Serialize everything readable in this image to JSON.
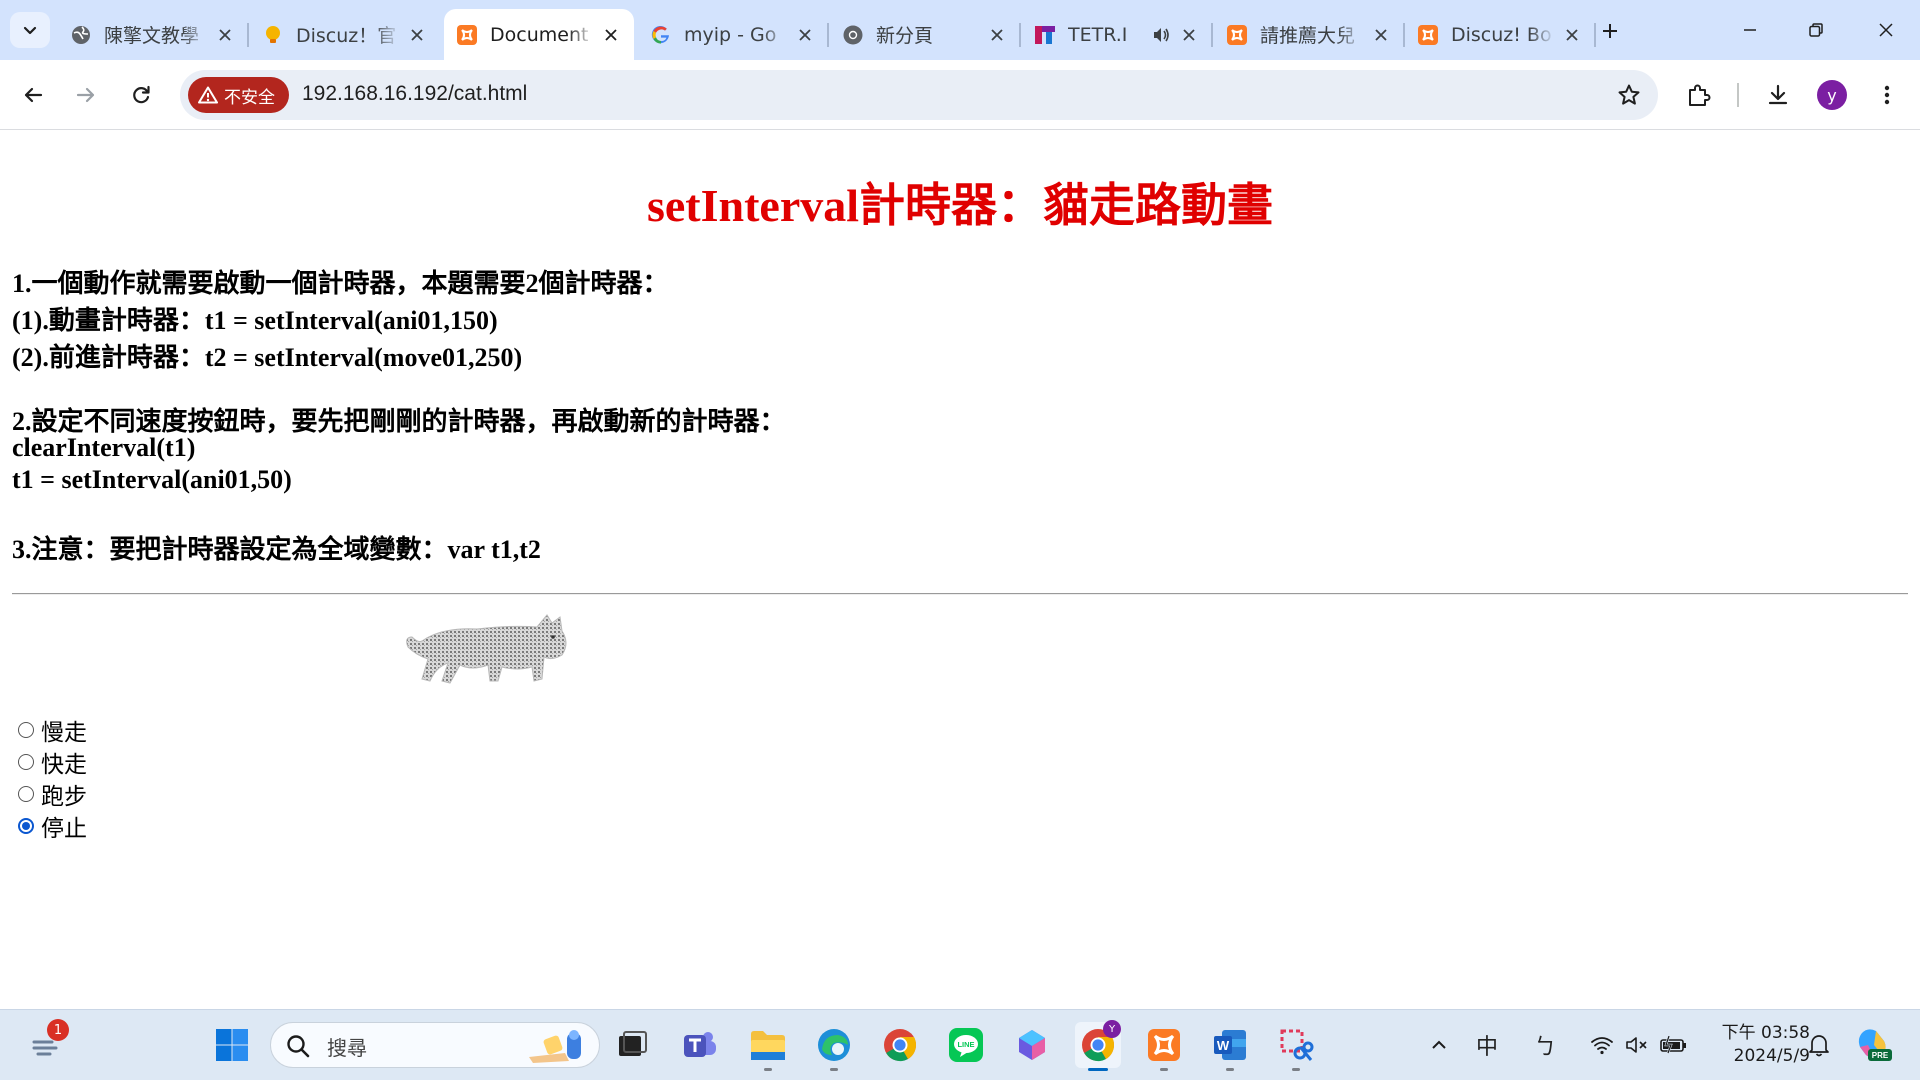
{
  "browser": {
    "tabs": [
      {
        "title": "陳擎文教學",
        "icon": "globe-icon",
        "active": false
      },
      {
        "title": "Discuz！官",
        "icon": "discuz-bulb-icon",
        "active": false
      },
      {
        "title": "Document",
        "icon": "xampp-icon",
        "active": true
      },
      {
        "title": "myip - Go",
        "icon": "google-icon",
        "active": false
      },
      {
        "title": "新分頁",
        "icon": "chrome-icon",
        "active": false
      },
      {
        "title": "TETR.I",
        "icon": "tetris-icon",
        "active": false,
        "audio": true
      },
      {
        "title": "請推薦大兒",
        "icon": "xampp-icon",
        "active": false
      },
      {
        "title": "Discuz! Bo",
        "icon": "xampp-icon",
        "active": false
      }
    ],
    "security_label": "不安全",
    "url": "192.168.16.192/cat.html",
    "profile_initial": "y"
  },
  "page": {
    "title": "setInterval計時器：貓走路動畫",
    "lines": [
      "1.一個動作就需要啟動一個計時器，本題需要2個計時器：",
      "(1).動畫計時器：t1 = setInterval(ani01,150)",
      "(2).前進計時器：t2 = setInterval(move01,250)",
      "2.設定不同速度按鈕時，要先把剛剛的計時器，再啟動新的計時器：",
      "clearInterval(t1)",
      "t1 = setInterval(ani01,50)",
      "3.注意：要把計時器設定為全域變數：var t1,t2"
    ],
    "speed_options": [
      {
        "label": "慢走",
        "checked": false
      },
      {
        "label": "快走",
        "checked": false
      },
      {
        "label": "跑步",
        "checked": false
      },
      {
        "label": "停止",
        "checked": true
      }
    ]
  },
  "taskbar": {
    "search_placeholder": "搜尋",
    "notification_badge": "1",
    "tray_ime": "中",
    "tray_ime_mode": "ㄅ",
    "clock_time": "下午 03:58",
    "clock_date": "2024/5/9",
    "chrome_profile_badge": "Y"
  },
  "colors": {
    "title_red": "#e00000",
    "insecure_red": "#b3261e",
    "tabstrip_bg": "#d3e3fd",
    "radio_accent": "#0b57d0"
  }
}
